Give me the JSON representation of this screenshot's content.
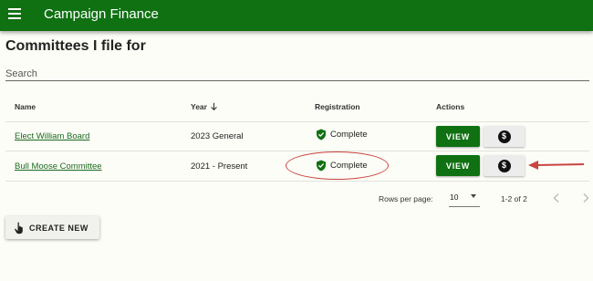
{
  "app": {
    "title": "Campaign Finance"
  },
  "page": {
    "title": "Committees I file for"
  },
  "search": {
    "placeholder": "Search"
  },
  "table": {
    "headers": {
      "name": "Name",
      "year": "Year",
      "registration": "Registration",
      "actions": "Actions"
    },
    "rows": [
      {
        "name": "Elect William Board",
        "year": "2023 General",
        "registration": "Complete",
        "view_label": "VIEW"
      },
      {
        "name": "Bull Moose Committee",
        "year": "2021 - Present",
        "registration": "Complete",
        "view_label": "VIEW"
      }
    ]
  },
  "pagination": {
    "rows_per_page_label": "Rows per page:",
    "rows_per_page_value": "10",
    "range": "1-2 of 2"
  },
  "create_button": {
    "label": "CREATE NEW"
  },
  "colors": {
    "brand_green": "#0f7112",
    "annotation_red": "#c9443f"
  },
  "icons": [
    "menu-icon",
    "sort-down-icon",
    "shield-check-icon",
    "dollar-circle-icon",
    "chevron-left-icon",
    "chevron-right-icon",
    "hand-pointer-icon"
  ]
}
